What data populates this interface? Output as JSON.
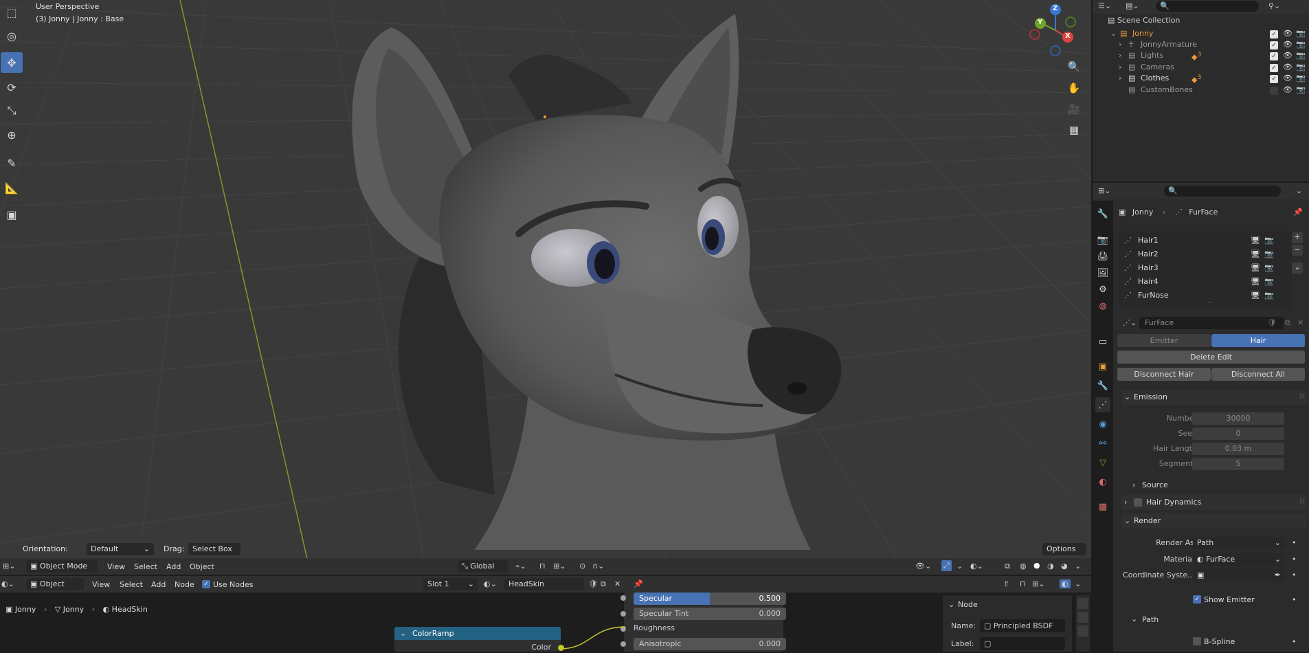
{
  "viewport": {
    "title": "User Perspective",
    "subtitle": "(3) Jonny | Jonny : Base",
    "gizmo": {
      "z": "Z",
      "y": "Y",
      "x": "X"
    },
    "tool_settings": {
      "orientation_label": "Orientation:",
      "orientation_value": "Default",
      "drag_label": "Drag:",
      "drag_value": "Select Box",
      "options_label": "Options"
    },
    "tools": [
      "cursor-select",
      "cursor-3d",
      "move",
      "rotate",
      "scale",
      "transform",
      "annotate",
      "measure",
      "add-cube"
    ]
  },
  "viewport_header": {
    "mode": "Object Mode",
    "menus": [
      "View",
      "Select",
      "Add",
      "Object"
    ],
    "transform_orientation": "Global"
  },
  "node_editor": {
    "editor_type": "Object",
    "menus": [
      "View",
      "Select",
      "Add",
      "Node"
    ],
    "use_nodes_label": "Use Nodes",
    "use_nodes_checked": true,
    "slot": "Slot 1",
    "material": "HeadSkin",
    "breadcrumb": [
      "Jonny",
      "Jonny",
      "HeadSkin"
    ],
    "nodes": {
      "specular_label": "Specular",
      "specular_value": "0.500",
      "specular_fill": 0.5,
      "specular_tint_label": "Specular Tint",
      "specular_tint_value": "0.000",
      "roughness_label": "Roughness",
      "anisotropic_label": "Anisotropic",
      "anisotropic_value": "0.000",
      "colorramp_title": "ColorRamp",
      "colorramp_output": "Color"
    },
    "sidebar": {
      "title": "Node",
      "name_label": "Name:",
      "name_value": "Principled BSDF",
      "label_label": "Label:",
      "label_value": ""
    }
  },
  "outliner": {
    "root": "Scene Collection",
    "items": [
      {
        "label": "Jonny",
        "color": "#e89a3c"
      },
      {
        "label": "JonnyArmature",
        "color": "#9a9a9a"
      },
      {
        "label": "Lights",
        "color": "#9a9a9a",
        "badge": "3"
      },
      {
        "label": "Cameras",
        "color": "#9a9a9a"
      },
      {
        "label": "Clothes",
        "color": "#e0e0e0",
        "badge": "3"
      },
      {
        "label": "CustomBones",
        "color": "#9a9a9a"
      }
    ]
  },
  "properties": {
    "breadcrumb_object": "Jonny",
    "breadcrumb_system": "FurFace",
    "particle_systems": [
      "Hair1",
      "Hair2",
      "Hair3",
      "Hair4",
      "FurNose"
    ],
    "settings_name": "FurFace",
    "type_tabs": [
      "Emitter",
      "Hair"
    ],
    "active_type": "Hair",
    "delete_edit": "Delete Edit",
    "disconnect_hair": "Disconnect Hair",
    "disconnect_all": "Disconnect All",
    "emission": {
      "title": "Emission",
      "number_label": "Number",
      "number_value": "30000",
      "seed_label": "Seed",
      "seed_value": "0",
      "hair_length_label": "Hair Length",
      "hair_length_value": "0.03 m",
      "segments_label": "Segments",
      "segments_value": "5",
      "source_label": "Source"
    },
    "hair_dynamics_label": "Hair Dynamics",
    "render": {
      "title": "Render",
      "render_as_label": "Render As",
      "render_as_value": "Path",
      "material_label": "Material",
      "material_value": "FurFace",
      "coordinate_label": "Coordinate Syste...",
      "show_emitter_label": "Show Emitter",
      "path_label": "Path",
      "bspline_label": "B-Spline"
    }
  },
  "colors": {
    "accent": "#4772b3",
    "node_header": "#246283",
    "viewport_bg": "#393939",
    "gizmo_x": "#d9443c",
    "gizmo_y": "#6ea42a",
    "gizmo_z": "#3a74d3"
  }
}
